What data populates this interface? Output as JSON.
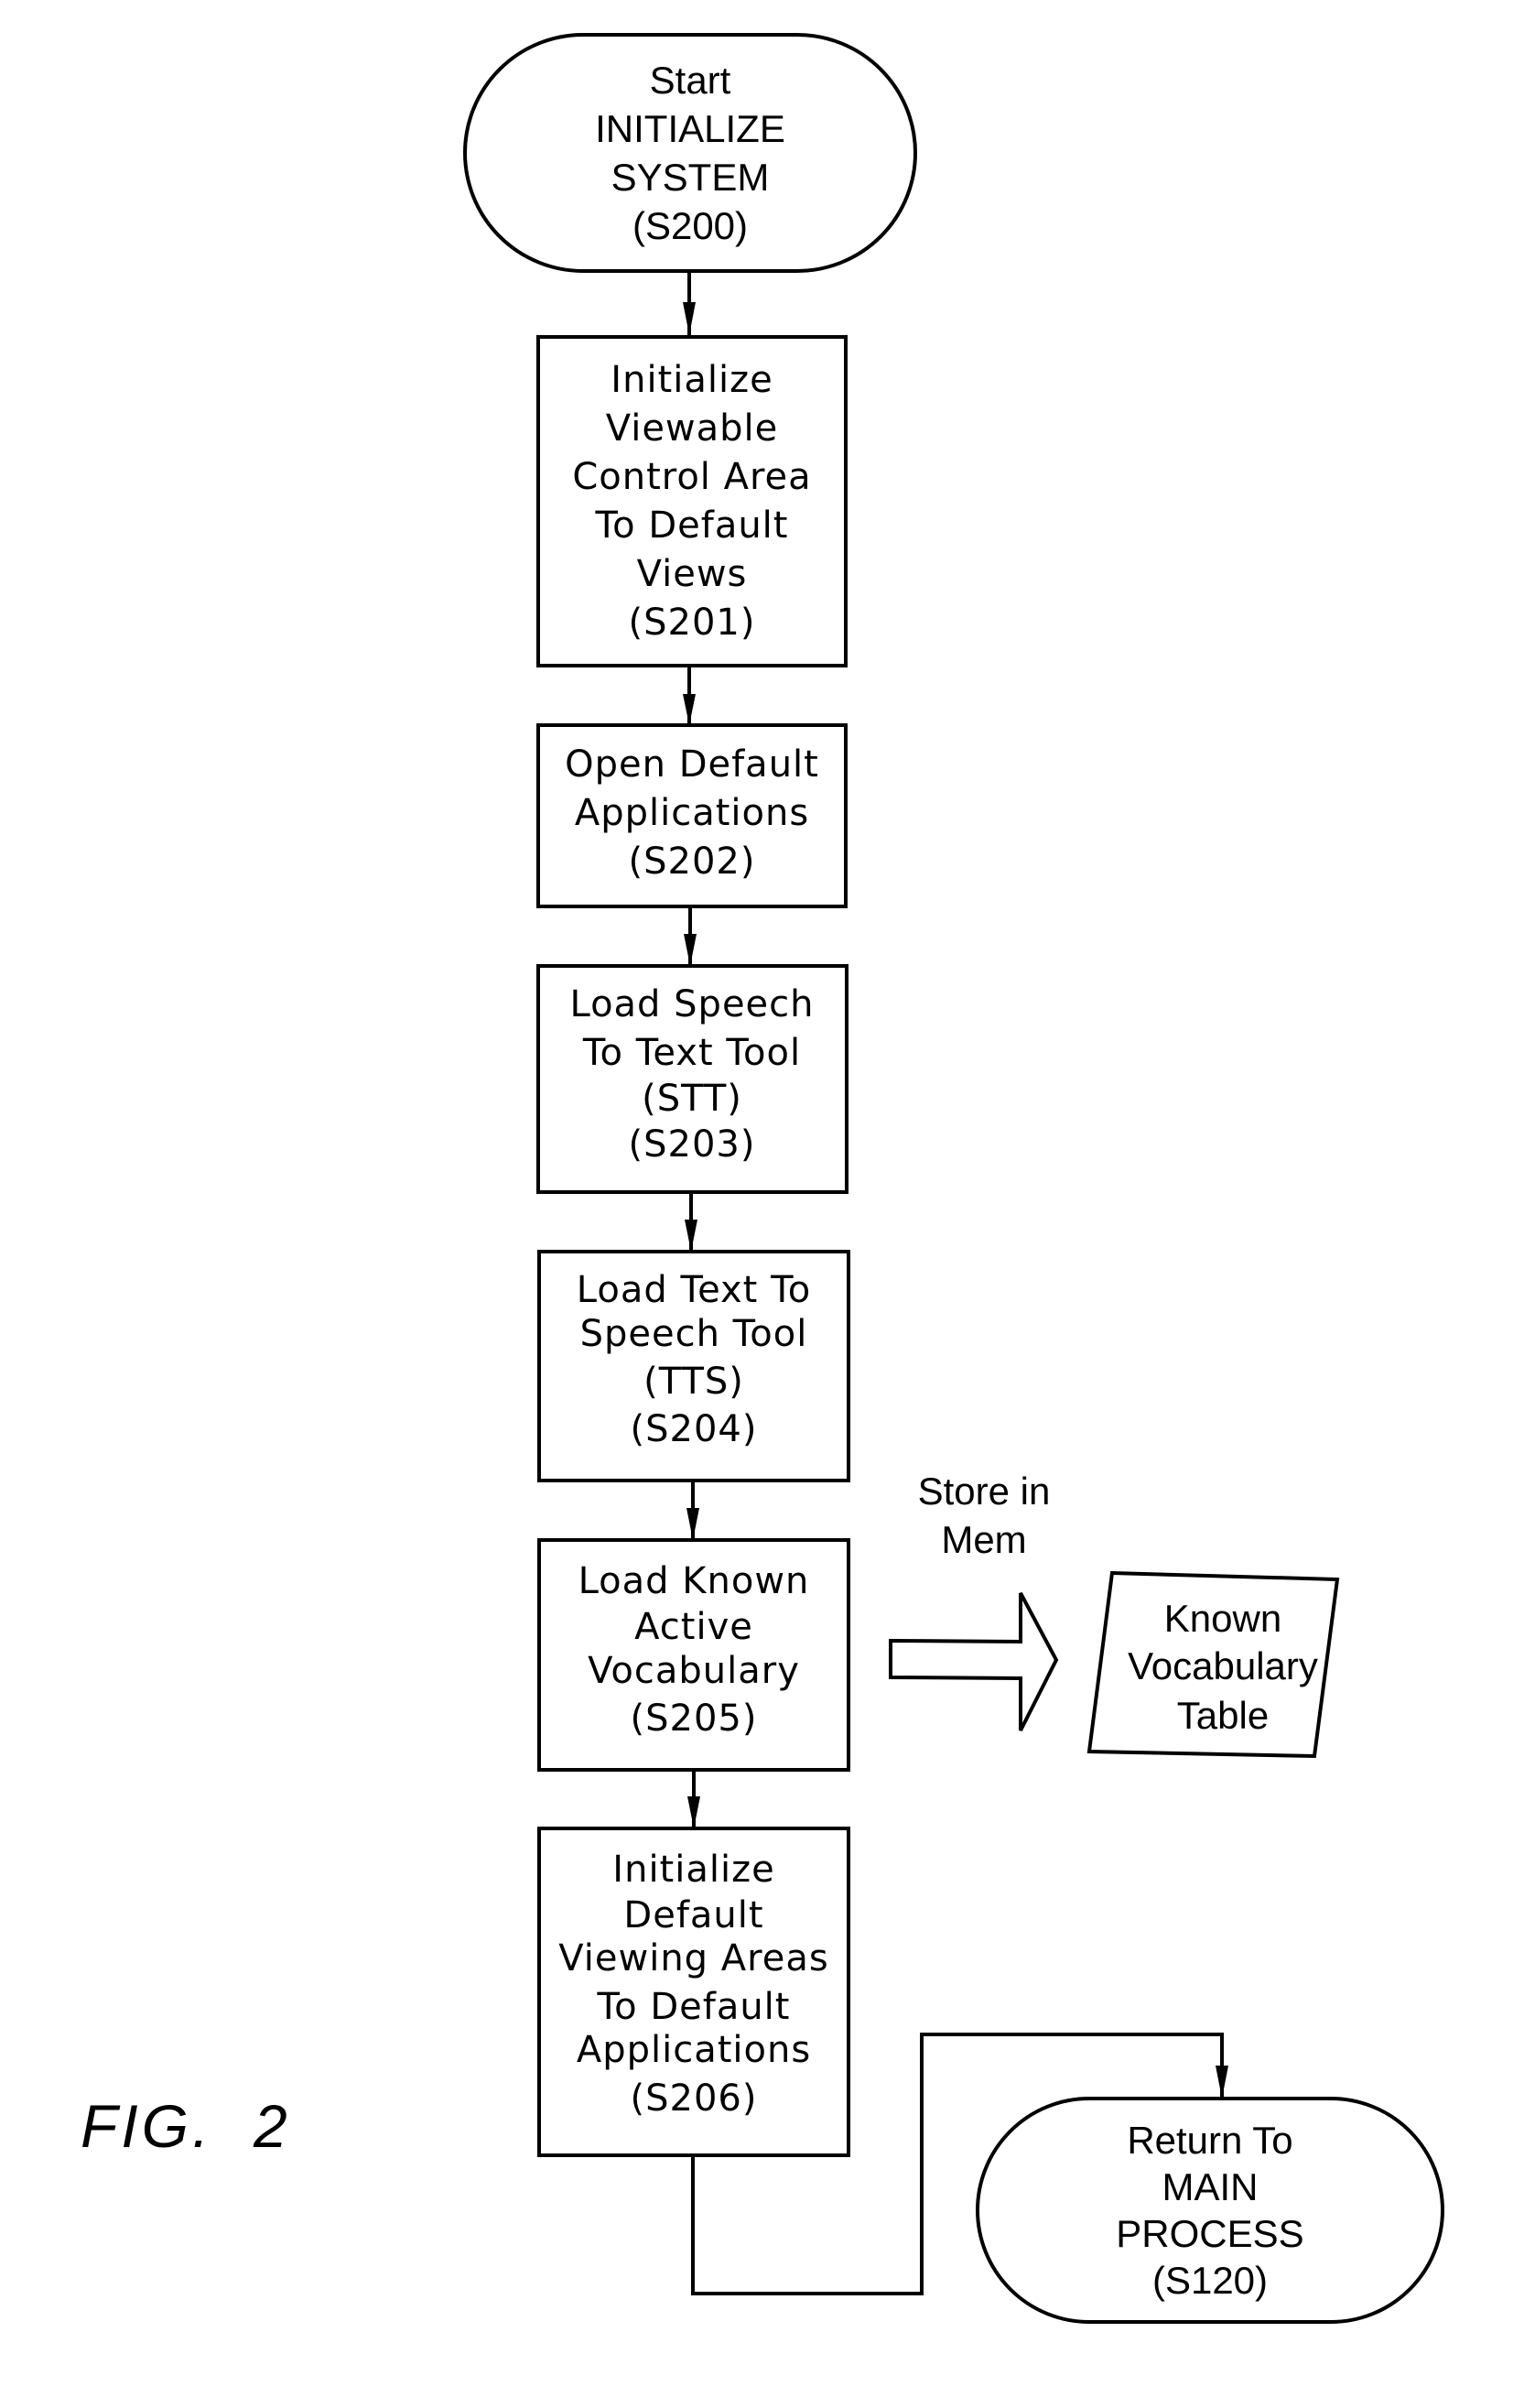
{
  "figure": {
    "label": "FIG.  2"
  },
  "terminals": {
    "start": {
      "lines": [
        "Start",
        "INITIALIZE",
        "SYSTEM",
        "(S200)"
      ]
    },
    "end": {
      "lines": [
        "Return To",
        "MAIN",
        "PROCESS",
        "(S120)"
      ]
    }
  },
  "steps": [
    {
      "id": "S201",
      "lines": [
        "Initialize",
        "Viewable",
        "Control  Area",
        "To  Default",
        "Views",
        "(S201)"
      ]
    },
    {
      "id": "S202",
      "lines": [
        "Open  Default",
        "Applications",
        "(S202)"
      ]
    },
    {
      "id": "S203",
      "lines": [
        "Load  Speech",
        "To  Text  Tool",
        "(STT)",
        "(S203)"
      ]
    },
    {
      "id": "S204",
      "lines": [
        "Load  Text  To",
        "Speech  Tool",
        "(TTS)",
        "(S204)"
      ]
    },
    {
      "id": "S205",
      "lines": [
        "Load  Known",
        "Active",
        "Vocabulary",
        "(S205)"
      ]
    },
    {
      "id": "S206",
      "lines": [
        "Initialize",
        "Default",
        "Viewing  Areas",
        "To  Default",
        "Applications",
        "(S206)"
      ]
    }
  ],
  "side_flow": {
    "arrow_label_lines": [
      "Store  in",
      "Mem"
    ],
    "storage": {
      "lines": [
        "Known",
        "Vocabulary",
        "Table"
      ]
    }
  }
}
